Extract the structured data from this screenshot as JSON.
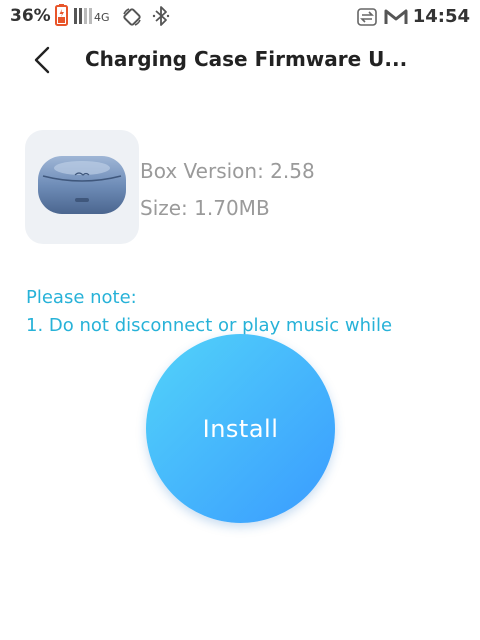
{
  "status_bar": {
    "battery": "36%",
    "network": "4G",
    "time": "14:54"
  },
  "header": {
    "title": "Charging Case Firmware U..."
  },
  "product": {
    "version_label": "Box Version: 2.58",
    "size_label": "Size: 1.70MB"
  },
  "notes": {
    "title": "Please note:",
    "line1": "1. Do not disconnect or play music while"
  },
  "install": {
    "label": "Install"
  },
  "colors": {
    "accent": "#27b2d8",
    "button_start": "#52d3f9",
    "button_end": "#3a9bff",
    "battery_icon": "#e8552a"
  }
}
